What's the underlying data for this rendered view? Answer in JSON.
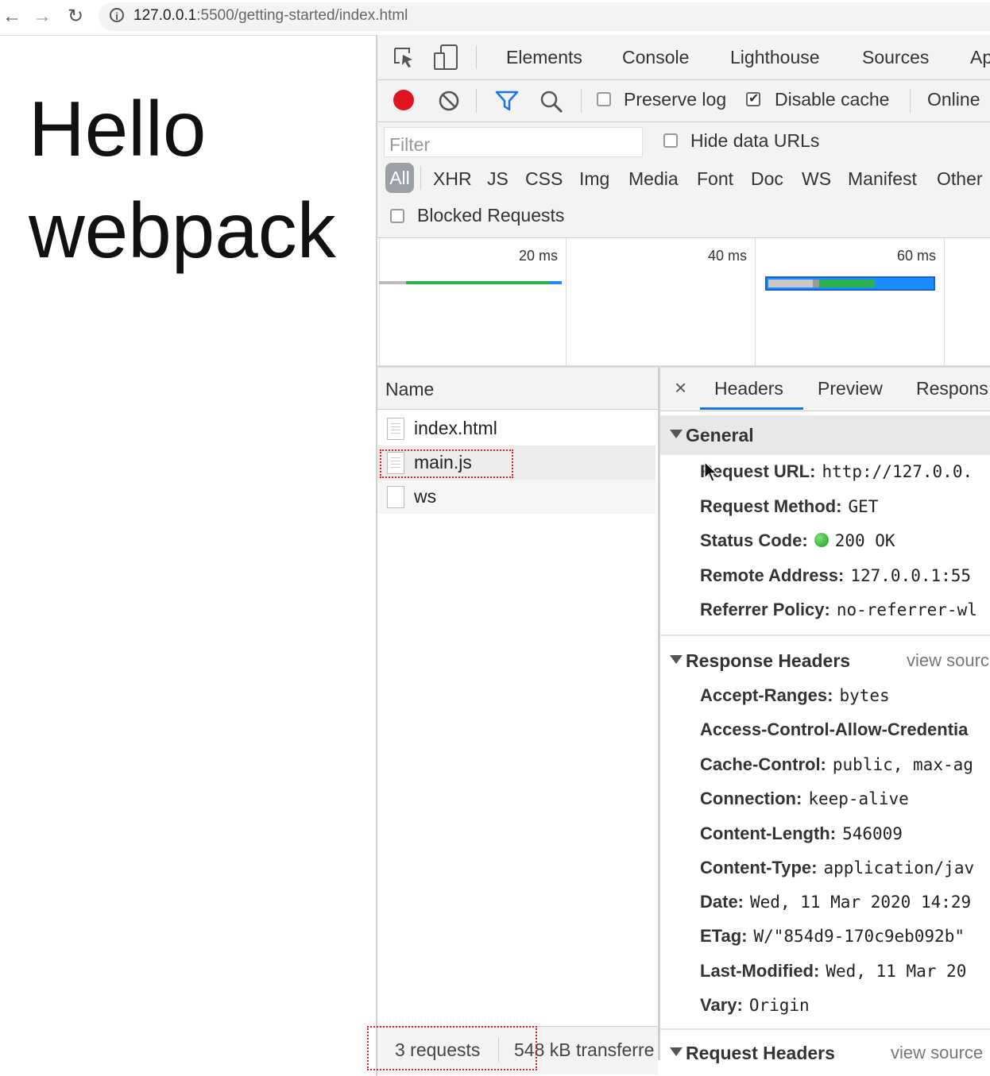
{
  "browser": {
    "back_icon": "arrow-left-icon",
    "forward_icon": "arrow-right-icon",
    "reload_icon": "reload-icon",
    "info_icon": "info-icon",
    "url_host": "127.0.0.1",
    "url_path": ":5500/getting-started/index.html"
  },
  "page": {
    "heading": "Hello webpack"
  },
  "devtools": {
    "tabs": [
      "Elements",
      "Console",
      "Lighthouse",
      "Sources",
      "Ap"
    ],
    "toolbar": {
      "preserve_log": "Preserve log",
      "disable_cache": "Disable cache",
      "throttle": "Online"
    },
    "filter": {
      "placeholder": "Filter",
      "hide_data_urls": "Hide data URLs",
      "types": [
        "All",
        "XHR",
        "JS",
        "CSS",
        "Img",
        "Media",
        "Font",
        "Doc",
        "WS",
        "Manifest",
        "Other"
      ],
      "blocked_requests": "Blocked Requests"
    },
    "overview": {
      "ticks": [
        "20 ms",
        "40 ms",
        "60 ms"
      ]
    },
    "requests": {
      "column_name": "Name",
      "rows": [
        "index.html",
        "main.js",
        "ws"
      ]
    },
    "status": {
      "requests": "3 requests",
      "transferred": "548 kB transferre"
    },
    "detail": {
      "close": "×",
      "tabs": [
        "Headers",
        "Preview",
        "Respons"
      ],
      "general": {
        "title": "General",
        "rows": [
          {
            "k": "Request URL:",
            "v": "http://127.0.0."
          },
          {
            "k": "Request Method:",
            "v": "GET"
          },
          {
            "k": "Status Code:",
            "v": "200 OK"
          },
          {
            "k": "Remote Address:",
            "v": "127.0.0.1:55"
          },
          {
            "k": "Referrer Policy:",
            "v": "no-referrer-wl"
          }
        ]
      },
      "response_headers": {
        "title": "Response Headers",
        "view_source": "view sourc",
        "rows": [
          {
            "k": "Accept-Ranges:",
            "v": "bytes"
          },
          {
            "k": "Access-Control-Allow-Credentia",
            "v": ""
          },
          {
            "k": "Cache-Control:",
            "v": "public, max-ag"
          },
          {
            "k": "Connection:",
            "v": "keep-alive"
          },
          {
            "k": "Content-Length:",
            "v": "546009"
          },
          {
            "k": "Content-Type:",
            "v": "application/jav"
          },
          {
            "k": "Date:",
            "v": "Wed, 11 Mar 2020 14:29"
          },
          {
            "k": "ETag:",
            "v": "W/\"854d9-170c9eb092b\""
          },
          {
            "k": "Last-Modified:",
            "v": "Wed, 11 Mar 20"
          },
          {
            "k": "Vary:",
            "v": "Origin"
          }
        ]
      },
      "request_headers": {
        "title": "Request Headers",
        "view_source": "view source"
      }
    }
  }
}
